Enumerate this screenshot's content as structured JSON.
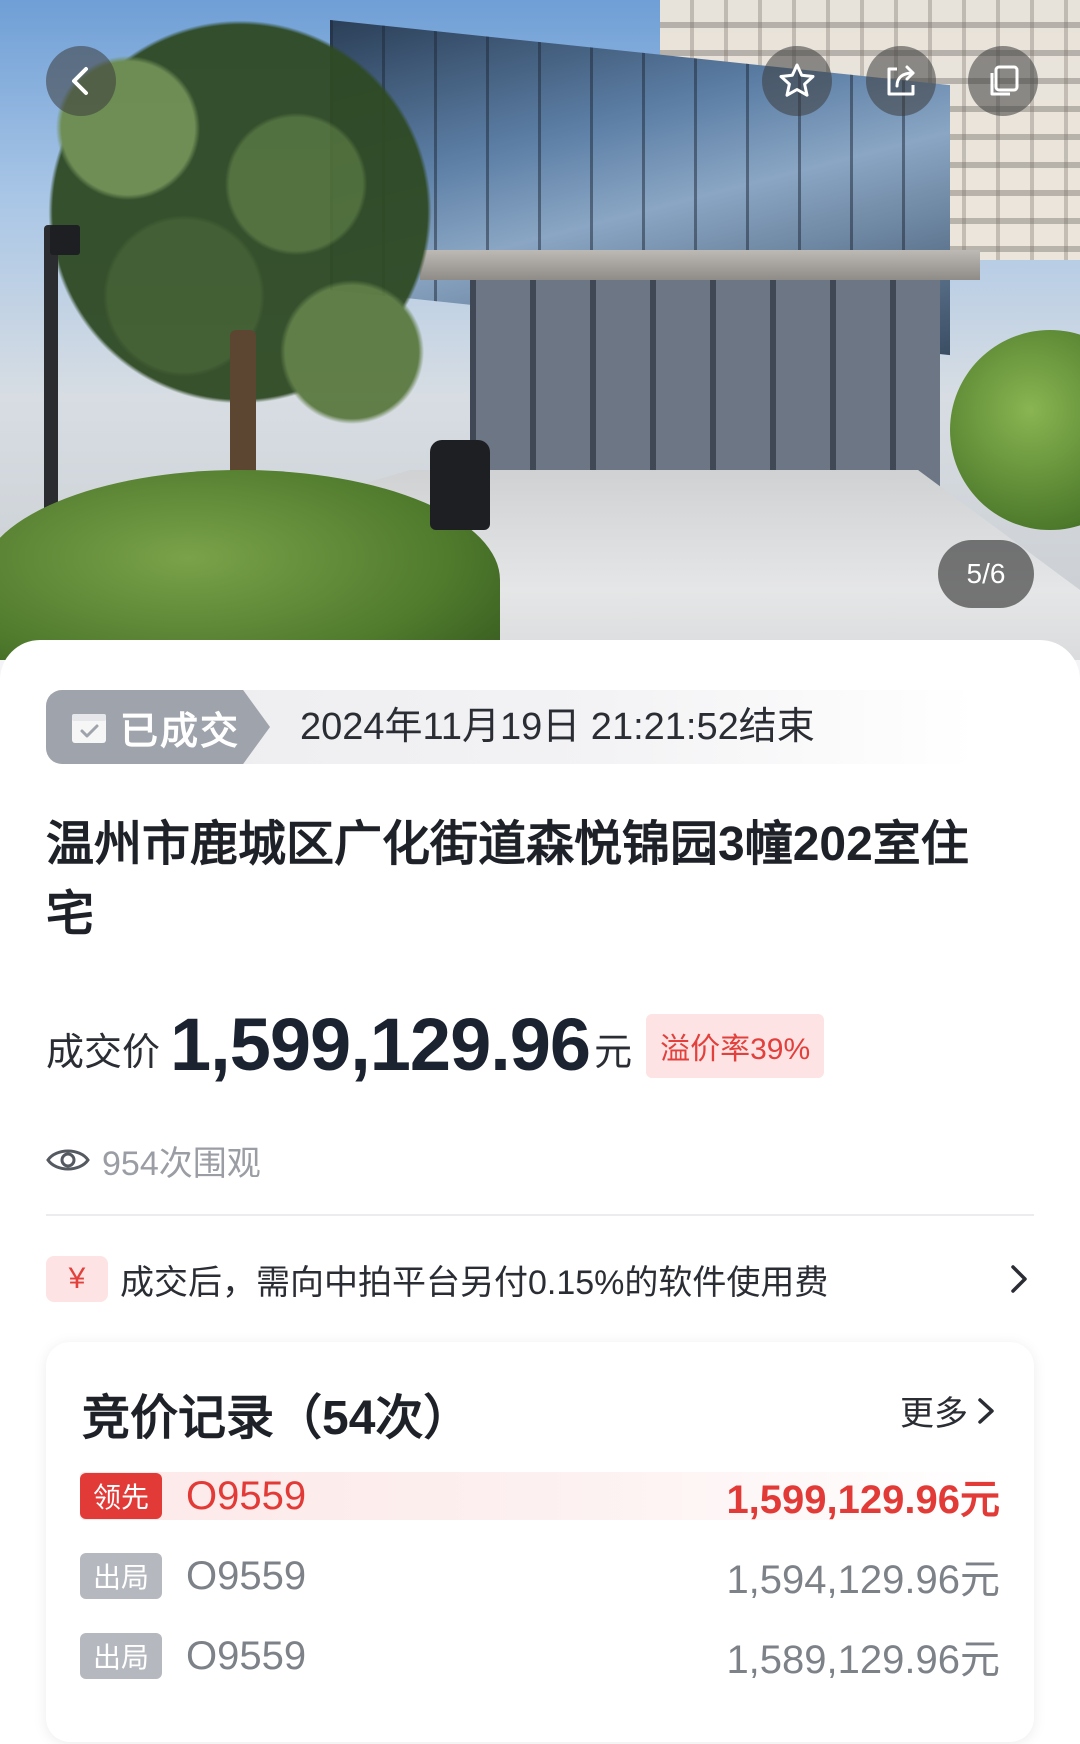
{
  "hero": {
    "photo_counter": "5/6",
    "icons": {
      "back": "back-chevron-icon",
      "favorite": "star-icon",
      "share": "share-icon",
      "copy": "copy-icon"
    }
  },
  "status": {
    "tag_label": "已成交",
    "end_time": "2024年11月19日  21:21:52结束"
  },
  "listing": {
    "title": "温州市鹿城区广化街道森悦锦园3幢202室住宅"
  },
  "price": {
    "label": "成交价",
    "value": "1,599,129.96",
    "unit": "元",
    "premium_rate": "溢价率39%"
  },
  "views": {
    "text": "954次围观"
  },
  "fee": {
    "badge": "¥",
    "text": "成交后，需向中拍平台另付0.15%的软件使用费"
  },
  "bids": {
    "title": "竞价记录（54次）",
    "more_label": "更多",
    "records": [
      {
        "tag": "领先",
        "bidder": "O9559",
        "amount": "1,599,129.96元",
        "status": "lead"
      },
      {
        "tag": "出局",
        "bidder": "O9559",
        "amount": "1,594,129.96元",
        "status": "out"
      },
      {
        "tag": "出局",
        "bidder": "O9559",
        "amount": "1,589,129.96元",
        "status": "out"
      }
    ]
  },
  "colors": {
    "accent_red": "#e23b37",
    "tag_gray": "#9fa3ab",
    "text_dark": "#1e2228"
  }
}
